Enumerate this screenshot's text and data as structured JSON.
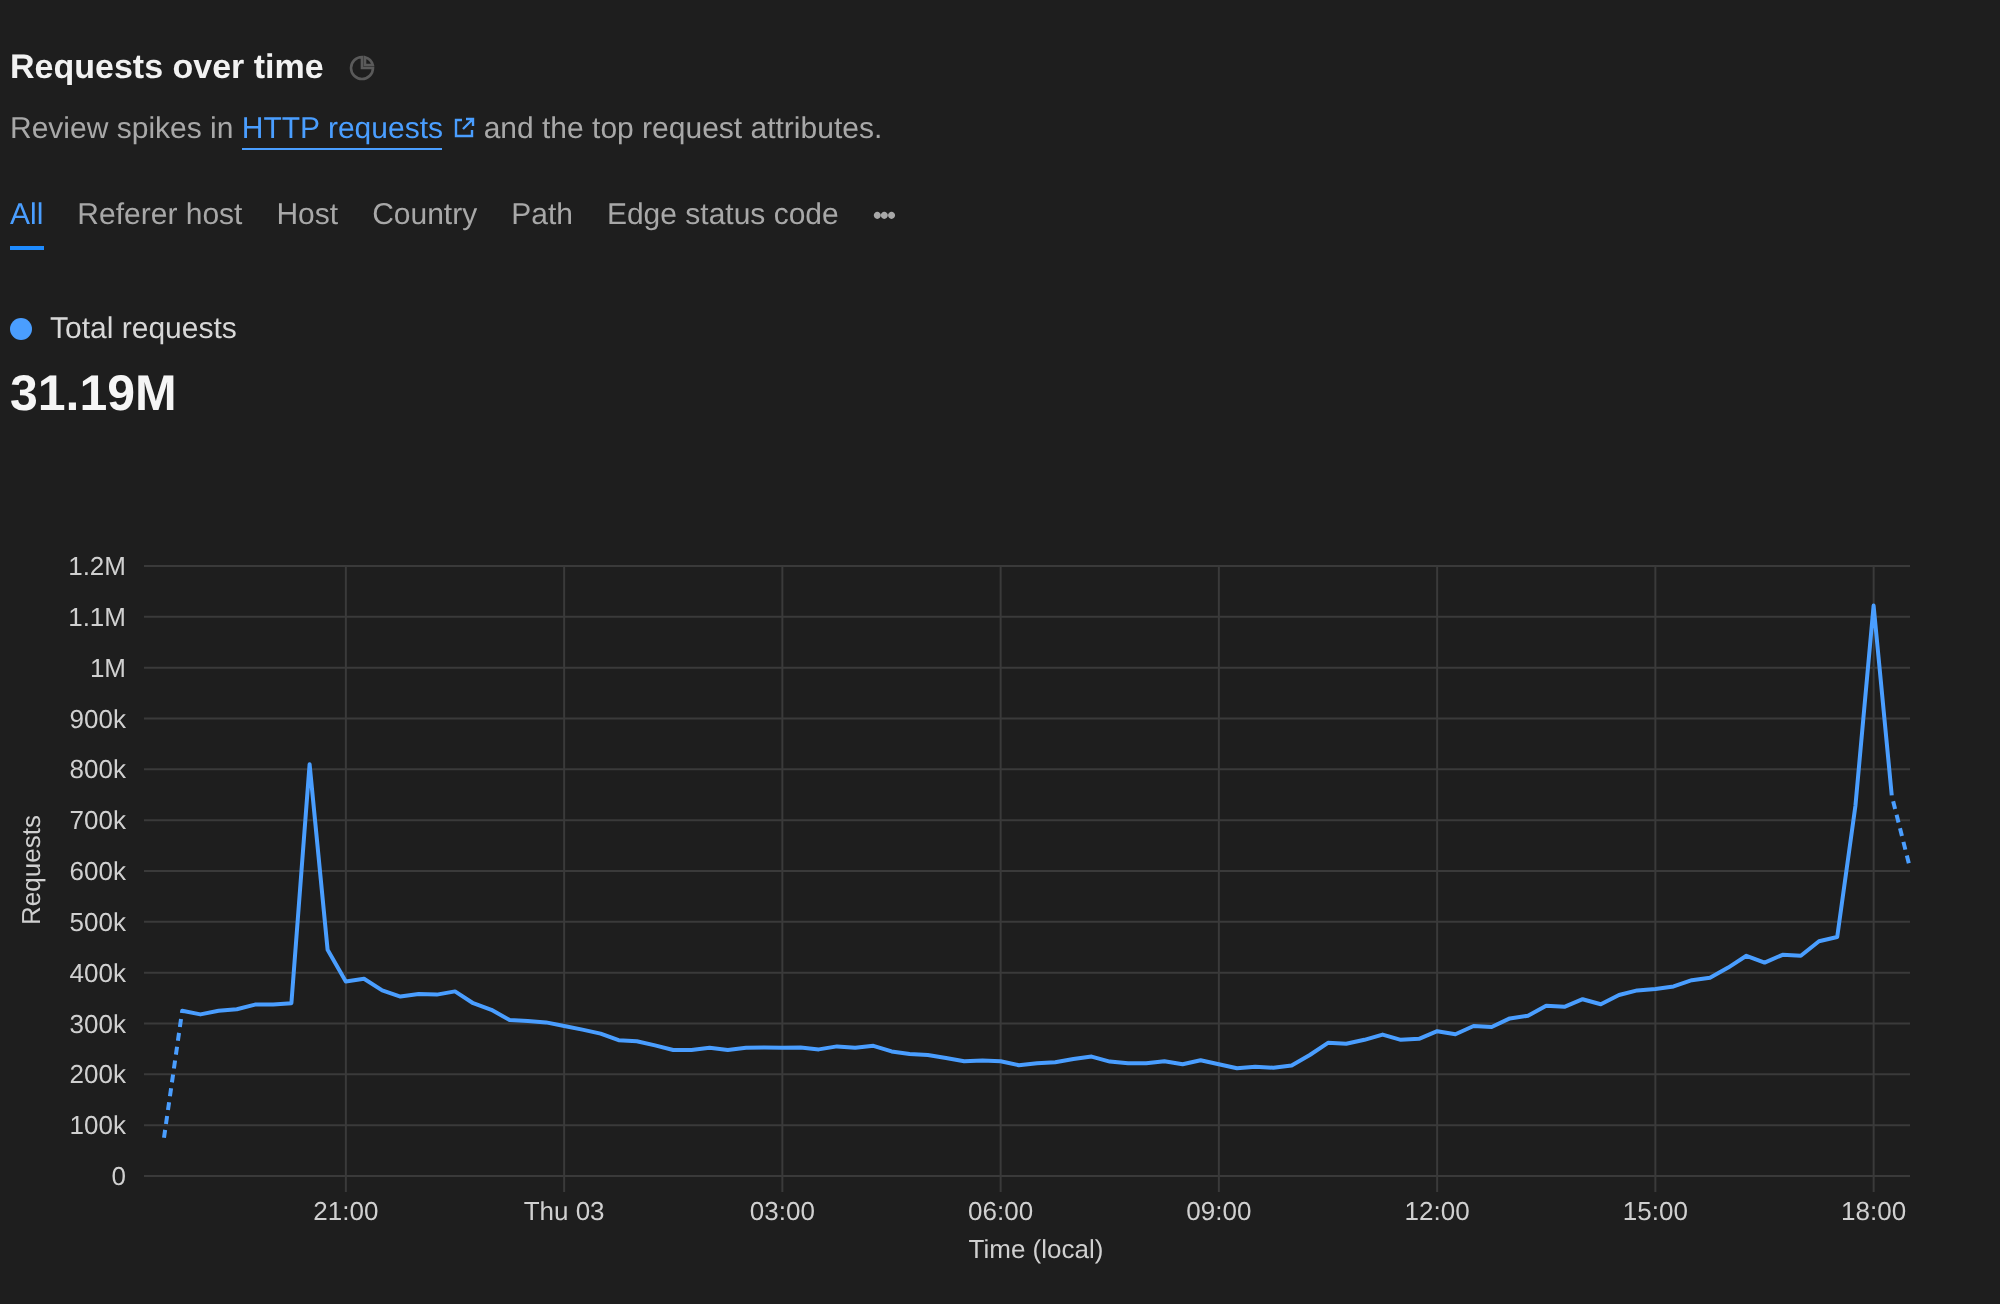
{
  "header": {
    "title": "Requests over time"
  },
  "description": {
    "before": "Review spikes in",
    "link": "HTTP requests",
    "after": "and the top request attributes."
  },
  "tabs": [
    {
      "label": "All",
      "selected": true
    },
    {
      "label": "Referer host",
      "selected": false
    },
    {
      "label": "Host",
      "selected": false
    },
    {
      "label": "Country",
      "selected": false
    },
    {
      "label": "Path",
      "selected": false
    },
    {
      "label": "Edge status code",
      "selected": false
    }
  ],
  "more_button": "•••",
  "summary": {
    "total": "31.19M"
  },
  "chart_data": {
    "type": "line",
    "xlabel": "Time (local)",
    "ylabel": "Requests",
    "categories": [
      null,
      null,
      null,
      null,
      null,
      null,
      null,
      null,
      null,
      null,
      "21:00",
      null,
      null,
      null,
      null,
      null,
      null,
      null,
      null,
      null,
      null,
      null,
      "Thu 03",
      null,
      null,
      null,
      null,
      null,
      null,
      null,
      null,
      null,
      null,
      null,
      "03:00",
      null,
      null,
      null,
      null,
      null,
      null,
      null,
      null,
      null,
      null,
      null,
      "06:00",
      null,
      null,
      null,
      null,
      null,
      null,
      null,
      null,
      null,
      null,
      null,
      "09:00",
      null,
      null,
      null,
      null,
      null,
      null,
      null,
      null,
      null,
      null,
      null,
      "12:00",
      null,
      null,
      null,
      null,
      null,
      null,
      null,
      null,
      null,
      null,
      null,
      "15:00",
      null,
      null,
      null,
      null,
      null,
      null,
      null,
      null,
      null,
      null,
      null,
      "18:00",
      null,
      null
    ],
    "grid": true,
    "series": [
      {
        "name": "Total requests",
        "color": "#4a9eff",
        "line_style": "dashed_ends",
        "values": [
          75000,
          325000,
          318000,
          325000,
          328000,
          337000,
          337000,
          340000,
          810000,
          445000,
          383000,
          388000,
          365000,
          353000,
          358000,
          357000,
          363000,
          340000,
          327000,
          307000,
          305000,
          302000,
          295000,
          288000,
          280000,
          267000,
          265000,
          257000,
          248000,
          248000,
          252000,
          248000,
          252000,
          253000,
          252000,
          253000,
          249000,
          255000,
          252000,
          256000,
          245000,
          240000,
          238000,
          232000,
          226000,
          227000,
          226000,
          218000,
          222000,
          224000,
          230000,
          235000,
          225000,
          222000,
          222000,
          226000,
          220000,
          228000,
          220000,
          212000,
          215000,
          213000,
          217000,
          238000,
          262000,
          260000,
          268000,
          278000,
          268000,
          270000,
          285000,
          279000,
          295000,
          293000,
          310000,
          315000,
          335000,
          333000,
          348000,
          338000,
          356000,
          365000,
          368000,
          373000,
          385000,
          390000,
          410000,
          433000,
          420000,
          435000,
          433000,
          462000,
          470000,
          728000,
          1122000,
          748000,
          606000
        ]
      }
    ],
    "ylim": [
      0,
      1200000
    ],
    "yticks": [
      {
        "value": 0,
        "label": "0"
      },
      {
        "value": 100000,
        "label": "100k"
      },
      {
        "value": 200000,
        "label": "200k"
      },
      {
        "value": 300000,
        "label": "300k"
      },
      {
        "value": 400000,
        "label": "400k"
      },
      {
        "value": 500000,
        "label": "500k"
      },
      {
        "value": 600000,
        "label": "600k"
      },
      {
        "value": 700000,
        "label": "700k"
      },
      {
        "value": 800000,
        "label": "800k"
      },
      {
        "value": 900000,
        "label": "900k"
      },
      {
        "value": 1000000,
        "label": "1M"
      },
      {
        "value": 1100000,
        "label": "1.1M"
      },
      {
        "value": 1200000,
        "label": "1.2M"
      }
    ]
  }
}
